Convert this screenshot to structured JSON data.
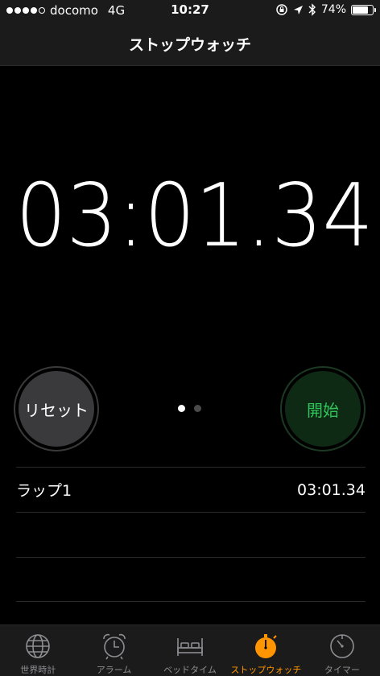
{
  "status_bar": {
    "carrier": "docomo",
    "network": "4G",
    "time": "10:27",
    "battery_percent": "74%",
    "battery_level": 0.74
  },
  "nav": {
    "title": "ストップウォッチ"
  },
  "stopwatch": {
    "time": "03:01.34"
  },
  "buttons": {
    "reset_label": "リセット",
    "start_label": "開始"
  },
  "page_dots": {
    "count": 2,
    "active_index": 0
  },
  "laps": [
    {
      "name": "ラップ1",
      "time": "03:01.34"
    }
  ],
  "tabs": [
    {
      "label": "世界時計",
      "icon": "globe-icon"
    },
    {
      "label": "アラーム",
      "icon": "alarm-clock-icon"
    },
    {
      "label": "ベッドタイム",
      "icon": "bed-icon"
    },
    {
      "label": "ストップウォッチ",
      "icon": "stopwatch-icon",
      "active": true
    },
    {
      "label": "タイマー",
      "icon": "timer-icon"
    }
  ],
  "colors": {
    "accent": "#ff9500",
    "start_text": "#31c45a",
    "start_bg": "#0e2a15",
    "reset_bg": "#3a3a3c"
  }
}
